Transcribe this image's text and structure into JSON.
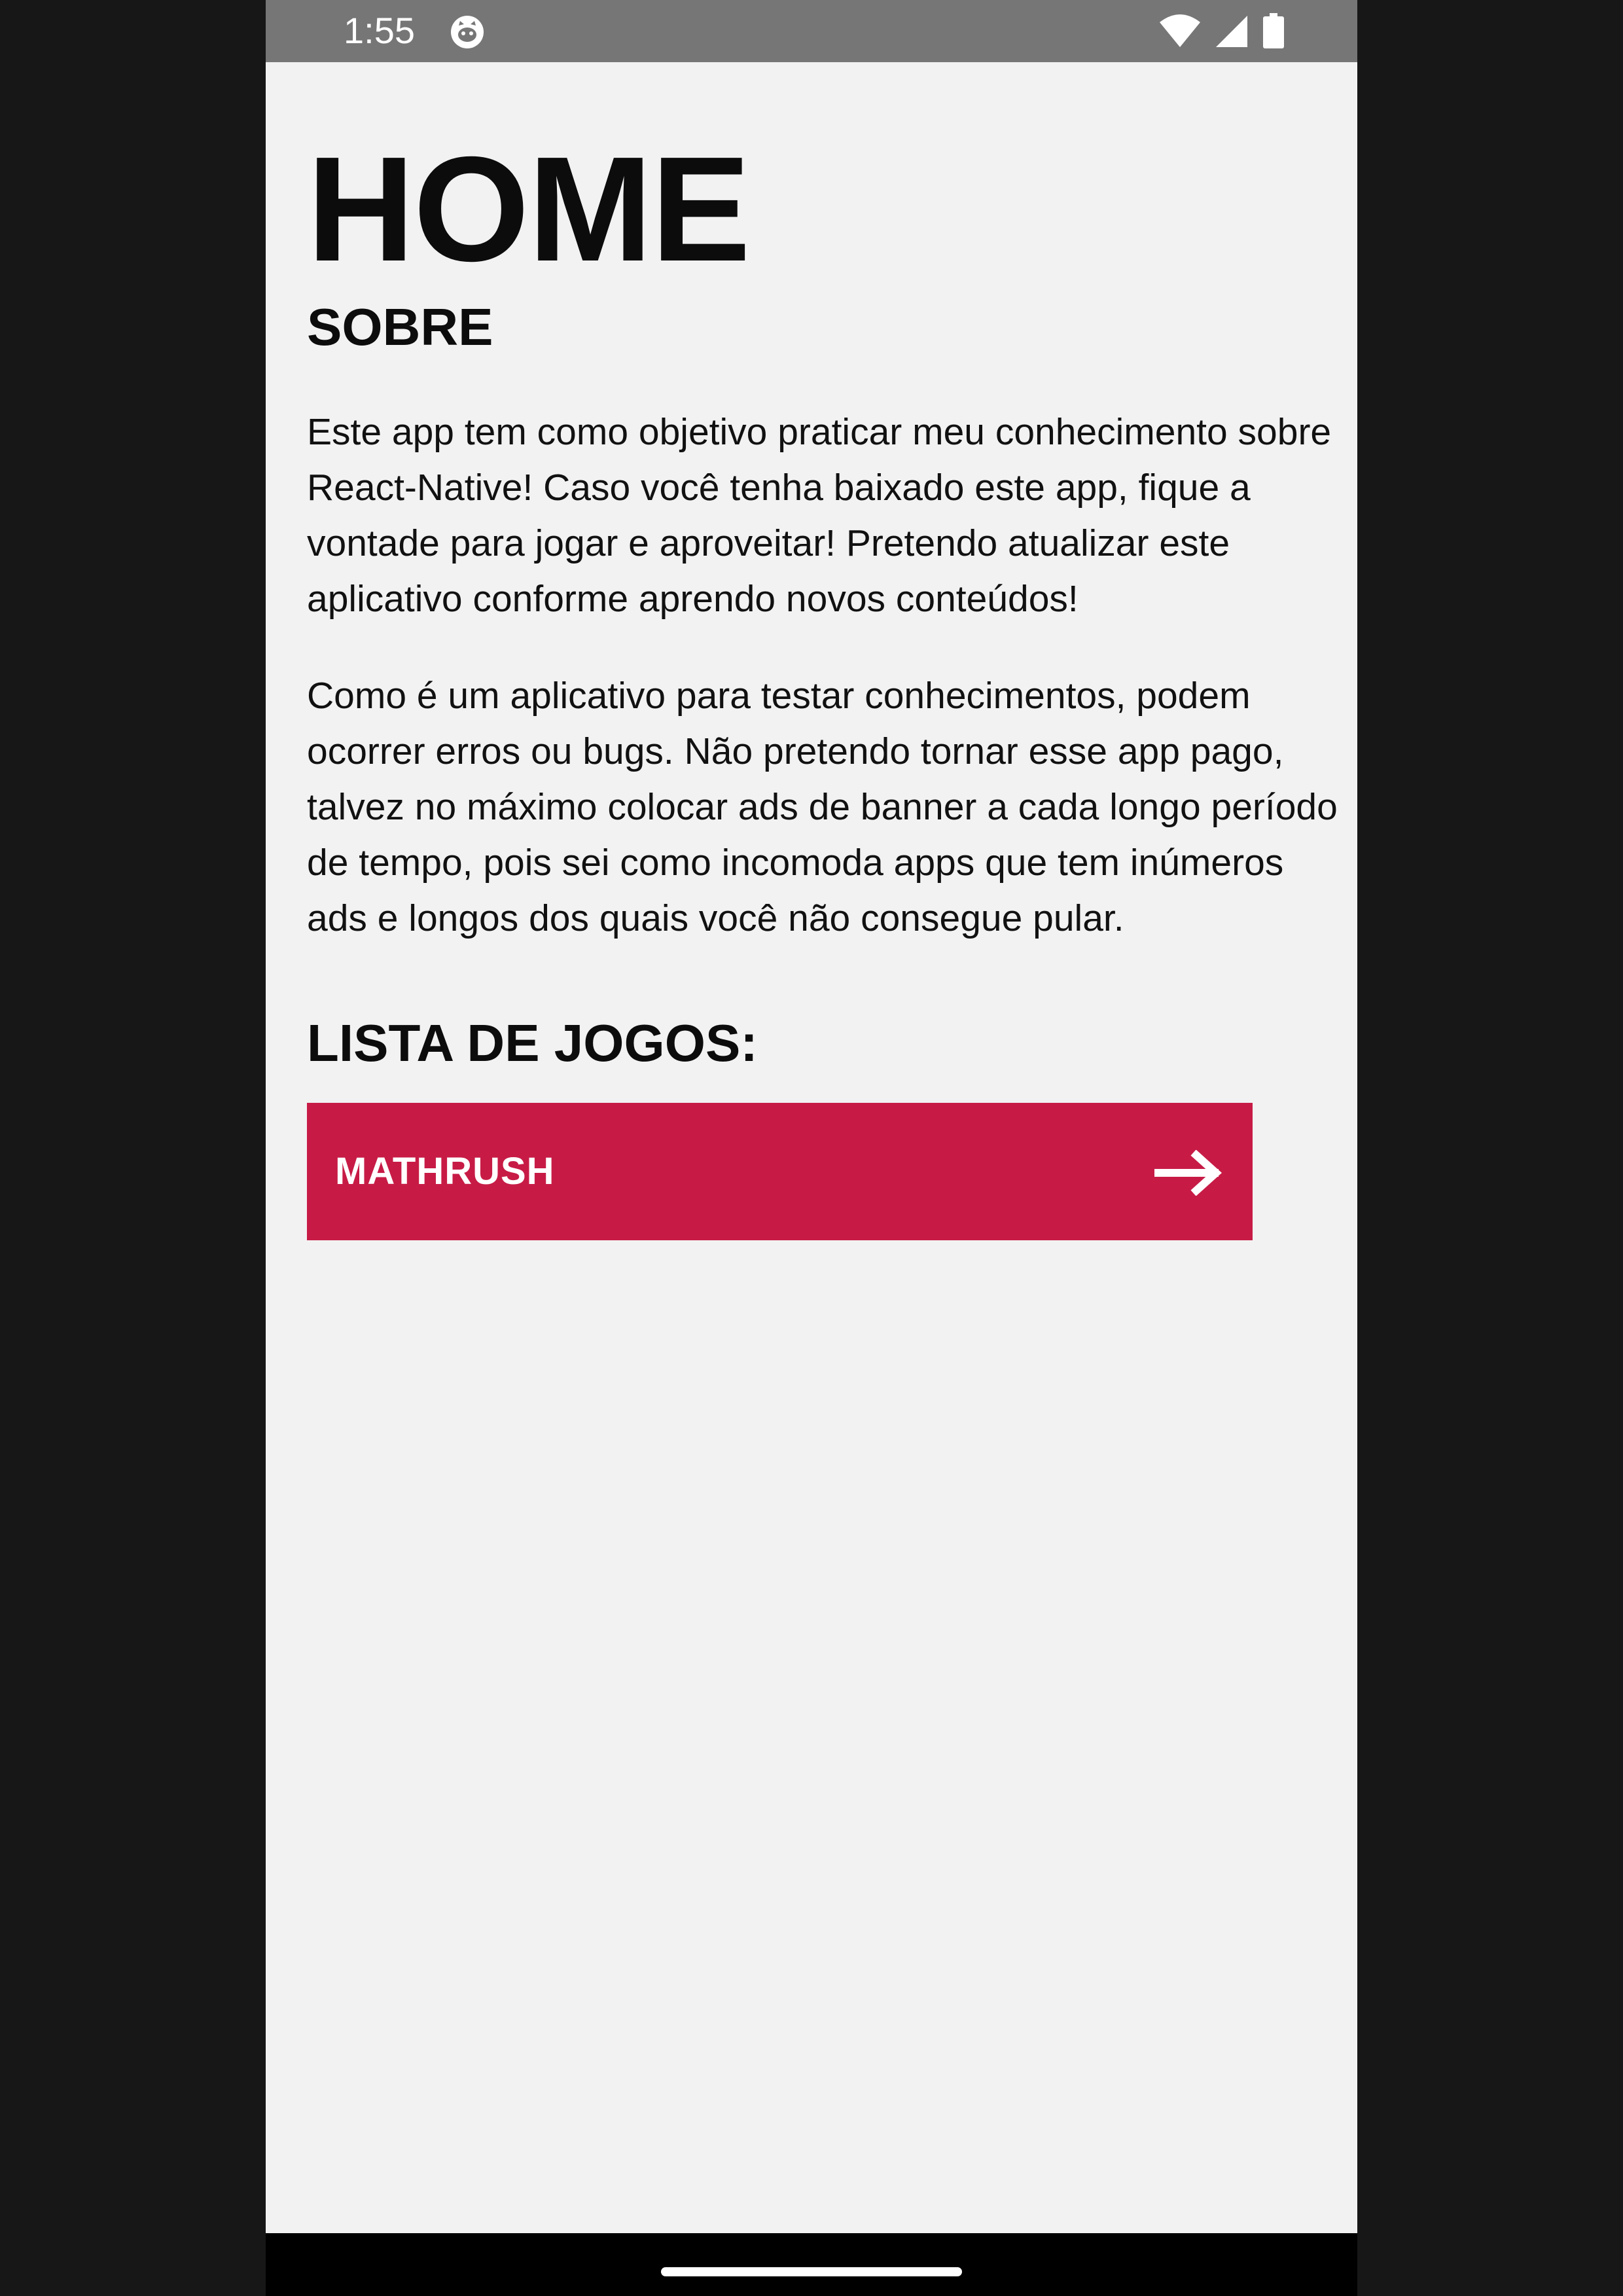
{
  "status_bar": {
    "time": "1:55",
    "app_icon": "cat-face-icon",
    "icons": [
      "wifi-icon",
      "signal-icon",
      "battery-icon"
    ]
  },
  "page": {
    "title": "HOME",
    "about_heading": "SOBRE",
    "paragraph_1": "Este app tem como objetivo praticar meu conhecimento sobre React-Native! Caso você tenha baixado este app, fique a vontade para jogar e aproveitar! Pretendo atualizar este aplicativo conforme aprendo novos conteúdos!",
    "paragraph_2": "Como é um aplicativo para testar conhecimentos, podem ocorrer erros ou bugs. Não pretendo tornar esse app pago, talvez no máximo colocar ads de banner a cada longo período de tempo, pois sei como incomoda apps que tem inúmeros ads e longos dos quais você não consegue pular.",
    "games_heading": "LISTA DE JOGOS:"
  },
  "games": [
    {
      "label": "MATHRUSH",
      "icon": "arrow-right-icon"
    }
  ],
  "colors": {
    "accent": "#c71b46",
    "background": "#f2f2f2",
    "status_bar": "#767676",
    "outer": "#171717"
  }
}
